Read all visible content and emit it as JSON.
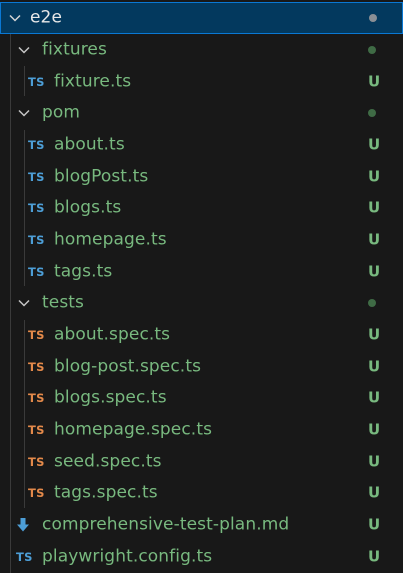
{
  "explorer": {
    "root": {
      "label": "e2e",
      "status": "modified-dot"
    },
    "items": [
      {
        "type": "folder",
        "label": "fixtures",
        "depth": 1,
        "status": "dot"
      },
      {
        "type": "file",
        "icon": "TS",
        "icon_color": "#4d9ed6",
        "label": "fixture.ts",
        "depth": 2,
        "status": "U"
      },
      {
        "type": "folder",
        "label": "pom",
        "depth": 1,
        "status": "dot"
      },
      {
        "type": "file",
        "icon": "TS",
        "icon_color": "#4d9ed6",
        "label": "about.ts",
        "depth": 2,
        "status": "U"
      },
      {
        "type": "file",
        "icon": "TS",
        "icon_color": "#4d9ed6",
        "label": "blogPost.ts",
        "depth": 2,
        "status": "U"
      },
      {
        "type": "file",
        "icon": "TS",
        "icon_color": "#4d9ed6",
        "label": "blogs.ts",
        "depth": 2,
        "status": "U"
      },
      {
        "type": "file",
        "icon": "TS",
        "icon_color": "#4d9ed6",
        "label": "homepage.ts",
        "depth": 2,
        "status": "U"
      },
      {
        "type": "file",
        "icon": "TS",
        "icon_color": "#4d9ed6",
        "label": "tags.ts",
        "depth": 2,
        "status": "U"
      },
      {
        "type": "folder",
        "label": "tests",
        "depth": 1,
        "status": "dot"
      },
      {
        "type": "file",
        "icon": "TS",
        "icon_color": "#e3894a",
        "label": "about.spec.ts",
        "depth": 2,
        "status": "U"
      },
      {
        "type": "file",
        "icon": "TS",
        "icon_color": "#e3894a",
        "label": "blog-post.spec.ts",
        "depth": 2,
        "status": "U"
      },
      {
        "type": "file",
        "icon": "TS",
        "icon_color": "#e3894a",
        "label": "blogs.spec.ts",
        "depth": 2,
        "status": "U"
      },
      {
        "type": "file",
        "icon": "TS",
        "icon_color": "#e3894a",
        "label": "homepage.spec.ts",
        "depth": 2,
        "status": "U"
      },
      {
        "type": "file",
        "icon": "TS",
        "icon_color": "#e3894a",
        "label": "seed.spec.ts",
        "depth": 2,
        "status": "U"
      },
      {
        "type": "file",
        "icon": "TS",
        "icon_color": "#e3894a",
        "label": "tags.spec.ts",
        "depth": 2,
        "status": "U"
      },
      {
        "type": "file",
        "icon": "md-download-icon",
        "icon_color": "#4d9ed6",
        "label": "comprehensive-test-plan.md",
        "depth": 1,
        "status": "U"
      },
      {
        "type": "file",
        "icon": "TS",
        "icon_color": "#4d9ed6",
        "label": "playwright.config.ts",
        "depth": 1,
        "status": "U"
      }
    ]
  }
}
